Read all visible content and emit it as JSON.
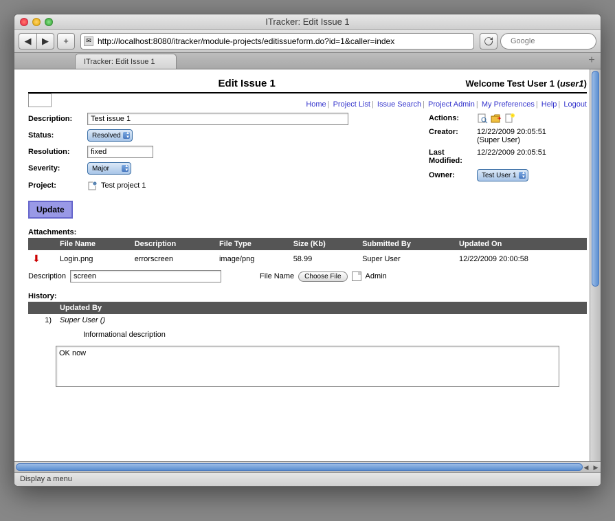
{
  "window": {
    "title": "ITracker: Edit Issue 1"
  },
  "url": "http://localhost:8080/itracker/module-projects/editissueform.do?id=1&caller=index",
  "search_placeholder": "Google",
  "tab": {
    "label": "ITracker: Edit Issue 1"
  },
  "page": {
    "title": "Edit Issue 1",
    "welcome_prefix": "Welcome Test User 1 (",
    "welcome_user": "user1",
    "welcome_suffix": ")"
  },
  "nav": {
    "home": "Home",
    "project_list": "Project List",
    "issue_search": "Issue Search",
    "project_admin": "Project Admin",
    "my_prefs": "My Preferences",
    "help": "Help",
    "logout": "Logout"
  },
  "labels": {
    "description": "Description:",
    "status": "Status:",
    "resolution": "Resolution:",
    "severity": "Severity:",
    "project": "Project:",
    "actions": "Actions:",
    "creator": "Creator:",
    "last_modified": "Last Modified:",
    "owner": "Owner:",
    "update": "Update",
    "attachments": "Attachments:",
    "history": "History:",
    "desc_short": "Description",
    "file_name_short": "File Name",
    "choose_file": "Choose File",
    "admin": "Admin"
  },
  "fields": {
    "description": "Test issue 1",
    "status": "Resolved",
    "resolution": "fixed",
    "severity": "Major",
    "project": "Test project 1",
    "creator_date": "12/22/2009 20:05:51",
    "creator_name": "(Super User)",
    "last_modified": "12/22/2009 20:05:51",
    "owner": "Test User 1"
  },
  "attachments": {
    "headers": {
      "file_name": "File Name",
      "description": "Description",
      "file_type": "File Type",
      "size": "Size (Kb)",
      "submitted_by": "Submitted By",
      "updated_on": "Updated On"
    },
    "rows": [
      {
        "file_name": "Login.png",
        "description": "errorscreen",
        "file_type": "image/png",
        "size": "58.99",
        "submitted_by": "Super User",
        "updated_on": "12/22/2009 20:00:58"
      }
    ],
    "new_description": "screen"
  },
  "history": {
    "header": "Updated By",
    "rows": [
      {
        "num": "1)",
        "by": "Super User ()",
        "desc": "Informational description"
      }
    ],
    "comment": "OK now"
  },
  "status_text": "Display a menu"
}
